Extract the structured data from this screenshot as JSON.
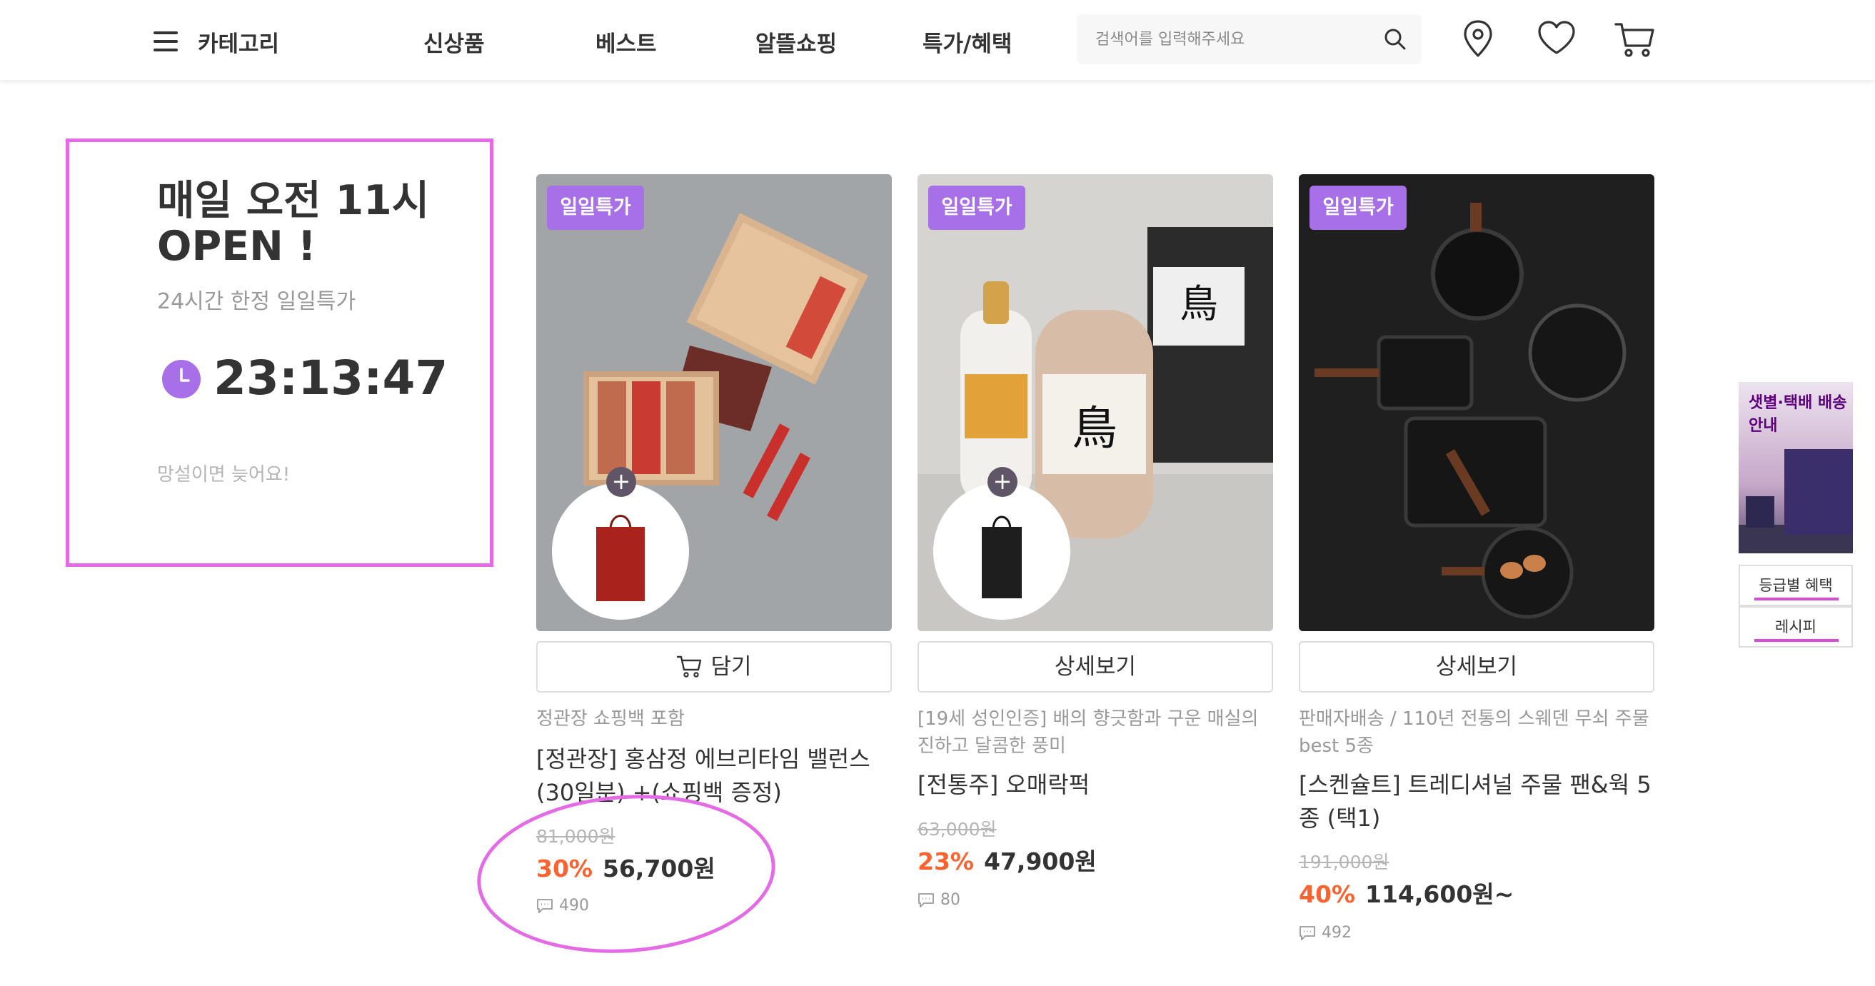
{
  "header": {
    "category_label": "카테고리",
    "nav": [
      "신상품",
      "베스트",
      "알뜰쇼핑",
      "특가/혜택"
    ],
    "search_placeholder": "검색어를 입력해주세요"
  },
  "promo": {
    "title": "매일 오전 11시 OPEN !",
    "subtitle": "24시간 한정 일일특가",
    "timer": "23:13:47",
    "note": "망설이면 늦어요!"
  },
  "products": [
    {
      "badge": "일일특가",
      "button_label": "담기",
      "description": "정관장 쇼핑백 포함",
      "name": "[정관장] 홍삼정 에브리타임 밸런스 (30일분) +(쇼핑백 증정)",
      "original_price": "81,000원",
      "discount": "30%",
      "price": "56,700원",
      "reviews": "490"
    },
    {
      "badge": "일일특가",
      "button_label": "상세보기",
      "description": "[19세 성인인증] 배의 향긋함과 구운 매실의 진하고 달콤한 풍미",
      "name": "[전통주] 오매락퍽",
      "original_price": "63,000원",
      "discount": "23%",
      "price": "47,900원",
      "reviews": "80"
    },
    {
      "badge": "일일특가",
      "button_label": "상세보기",
      "description": "판매자배송 / 110년 전통의 스웨덴 무쇠 주물 best 5종",
      "name": "[스켄슐트] 트레디셔널 주물 팬&웍 5종 (택1)",
      "original_price": "191,000원",
      "discount": "40%",
      "price": "114,600원~",
      "reviews": "492"
    }
  ],
  "side": {
    "banner_text": "샛별·택배 배송 안내",
    "links": [
      "등급별 혜택",
      "레시피"
    ]
  },
  "colors": {
    "accent_purple": "#a770e8",
    "discount_orange": "#fa622f",
    "annotation_pink": "#e56ae6"
  }
}
